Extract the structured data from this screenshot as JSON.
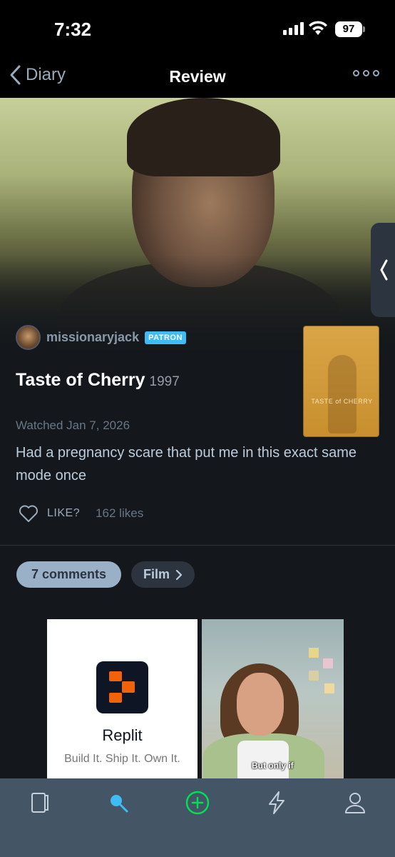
{
  "status_bar": {
    "time": "7:32",
    "battery": "97"
  },
  "nav": {
    "back_label": "Diary",
    "title": "Review"
  },
  "review": {
    "author": "missionaryjack",
    "badge": "PATRON",
    "film_title": "Taste of Cherry",
    "film_year": "1997",
    "watched": "Watched Jan 7, 2026",
    "text": "Had a pregnancy scare that put me in this exact same mode once",
    "like_label": "LIKE?",
    "likes": "162 likes",
    "poster_title": "TASTE of CHERRY"
  },
  "pills": {
    "comments": "7 comments",
    "film": "Film"
  },
  "ad": {
    "brand": "Replit",
    "tagline": "Build It. Ship It. Own It.",
    "caption": "But only if",
    "brand_color": "#f26207"
  },
  "tab_bar": {
    "items": [
      "films-icon",
      "search-icon",
      "add-icon",
      "activity-icon",
      "profile-icon"
    ],
    "active": "search-icon",
    "active_color": "#40bcf4",
    "add_color": "#00e054"
  }
}
